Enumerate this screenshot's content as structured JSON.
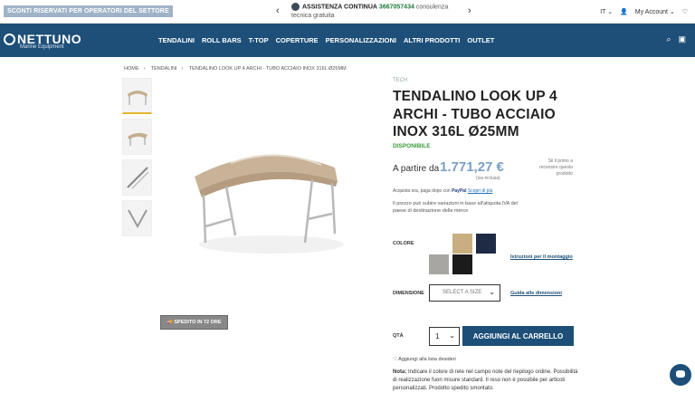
{
  "topbar": {
    "promo": "SCONTI RISERVATI PER OPERATORI DEL SETTORE",
    "prev_arrow": "‹",
    "next_arrow": "›",
    "assist_label": "ASSISTENZA CONTINUA",
    "assist_phone": "3667057434",
    "assist_tail": "consulenza tecnica gratuita",
    "language": "IT",
    "account": "My Account"
  },
  "nav": {
    "logo_brand": "NETTUNO",
    "logo_sub": "Marine Equipment",
    "items": [
      "TENDALINI",
      "ROLL BARS",
      "T-TOP",
      "COPERTURE",
      "PERSONALIZZAZIONI",
      "ALTRI PRODOTTI",
      "OUTLET"
    ]
  },
  "breadcrumb": [
    "HOME",
    "TENDALINI",
    "TENDALINO LOOK UP 4 ARCHI - TUBO ACCIAIO INOX 316L Ø25MM"
  ],
  "gallery": {
    "ship_button": "SPEDITO IN 72 ORE"
  },
  "product": {
    "brand": "TECH",
    "title": "TENDALINO LOOK UP 4 ARCHI - TUBO ACCIAIO INOX 316L Ø25MM",
    "availability": "DISPONIBILE",
    "price_label": "A partire da",
    "price": "1.771,27 €",
    "vat_note": "(iva inclusa)",
    "review_note": "Sii il primo a recensire questo prodotto",
    "paypal_text": "Acquista ora, paga dopo con",
    "paypal_brand": "PayPal",
    "paypal_link": "Scopri di più",
    "variation_note": "Il prezzo può subire variazioni in base all'aliquota IVA del paese di destinazione della merce",
    "color_label": "COLORE",
    "colors": [
      "#c9ae82",
      "#1f2a44",
      "#a8a6a2",
      "#1b1b1b"
    ],
    "mount_link": "Istruzioni per il montaggio",
    "size_label": "DIMENSIONE",
    "size_placeholder": "SELECT A SIZE",
    "size_guide": "Guida alle dimensioni",
    "qty_label": "QTÀ",
    "qty_value": "1",
    "add_to_cart": "AGGIUNGI AL CARRELLO",
    "wishlist": "Aggiungi alla lista desideri",
    "note_label": "Nota:",
    "note_text": "Indicare il colore di rete nel campo note del riepilogo ordine. Possibilità di realizzazione fuori misure standard. Il reso non è possibile per articoli personalizzati. Prodotto spedito smontato."
  }
}
